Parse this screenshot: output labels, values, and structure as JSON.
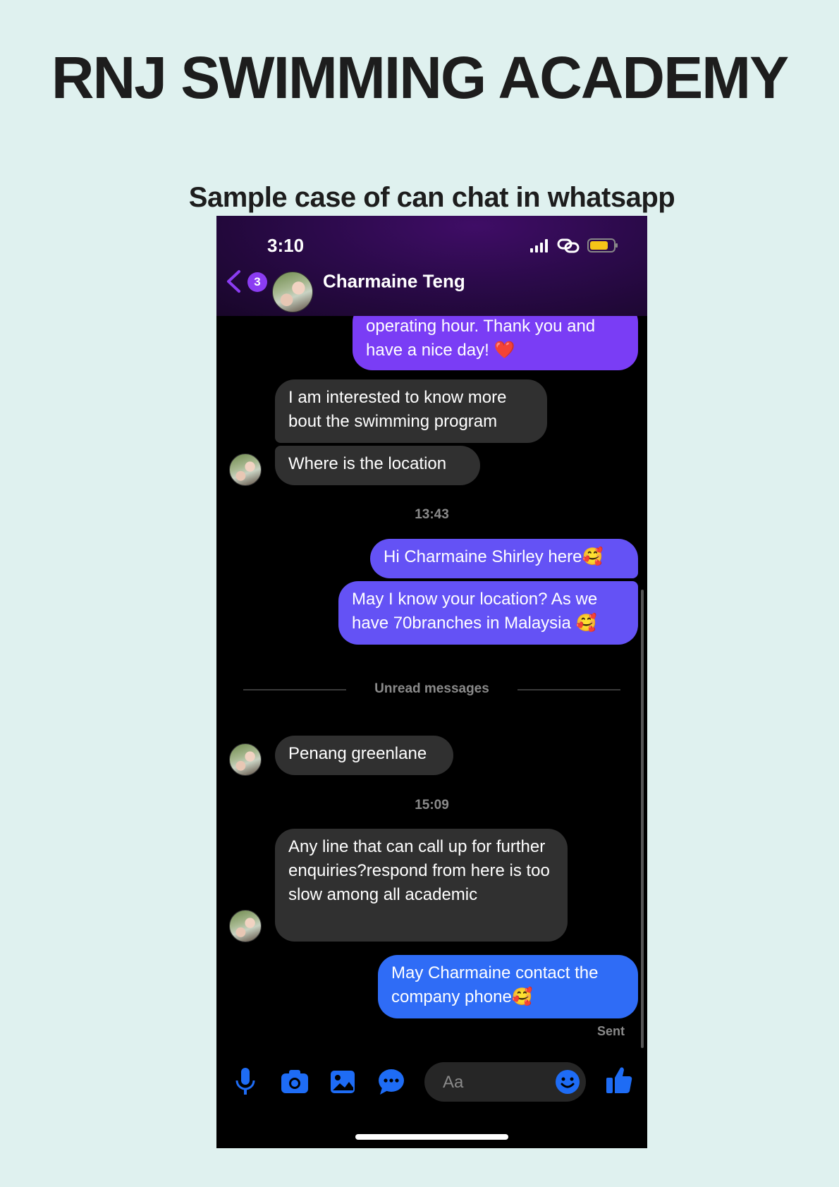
{
  "page": {
    "title": "RNJ SWIMMING ACADEMY",
    "subtitle": "Sample case of can chat in whatsapp"
  },
  "status_bar": {
    "time": "3:10"
  },
  "chat_header": {
    "back_badge_count": "3",
    "contact_name": "Charmaine Teng"
  },
  "messages": [
    {
      "sender": "me",
      "text": "operating hour. Thank you and have a nice day! ❤️"
    },
    {
      "sender": "contact",
      "text": "I am interested to know more bout the swimming program"
    },
    {
      "sender": "contact",
      "text": "Where is the location"
    },
    {
      "sender": "me",
      "text": "Hi Charmaine Shirley here🥰"
    },
    {
      "sender": "me",
      "text": "May I know your location? As we have 70branches in Malaysia 🥰"
    },
    {
      "sender": "contact",
      "text": "Penang greenlane"
    },
    {
      "sender": "contact",
      "text": "Any line that can call up for further enquiries?respond from here is too slow among all academic"
    },
    {
      "sender": "me",
      "text": "May Charmaine contact the company phone🥰"
    }
  ],
  "timestamps": [
    "13:43",
    "15:09"
  ],
  "unread_divider": "Unread messages",
  "delivery_status": "Sent",
  "composer": {
    "placeholder": "Aa"
  },
  "icons": {
    "status": [
      "signal-icon",
      "link-icon",
      "battery-icon"
    ],
    "toolbar": [
      "microphone-icon",
      "camera-icon",
      "gallery-icon",
      "chat-bubble-icon",
      "emoji-icon",
      "thumbs-up-icon"
    ]
  },
  "colors": {
    "page_background": "#dff1ef",
    "accent_blue": "#2f6cf6",
    "accent_purple": "#7a3df5",
    "incoming_bubble": "#303030",
    "battery": "#f5c518"
  }
}
